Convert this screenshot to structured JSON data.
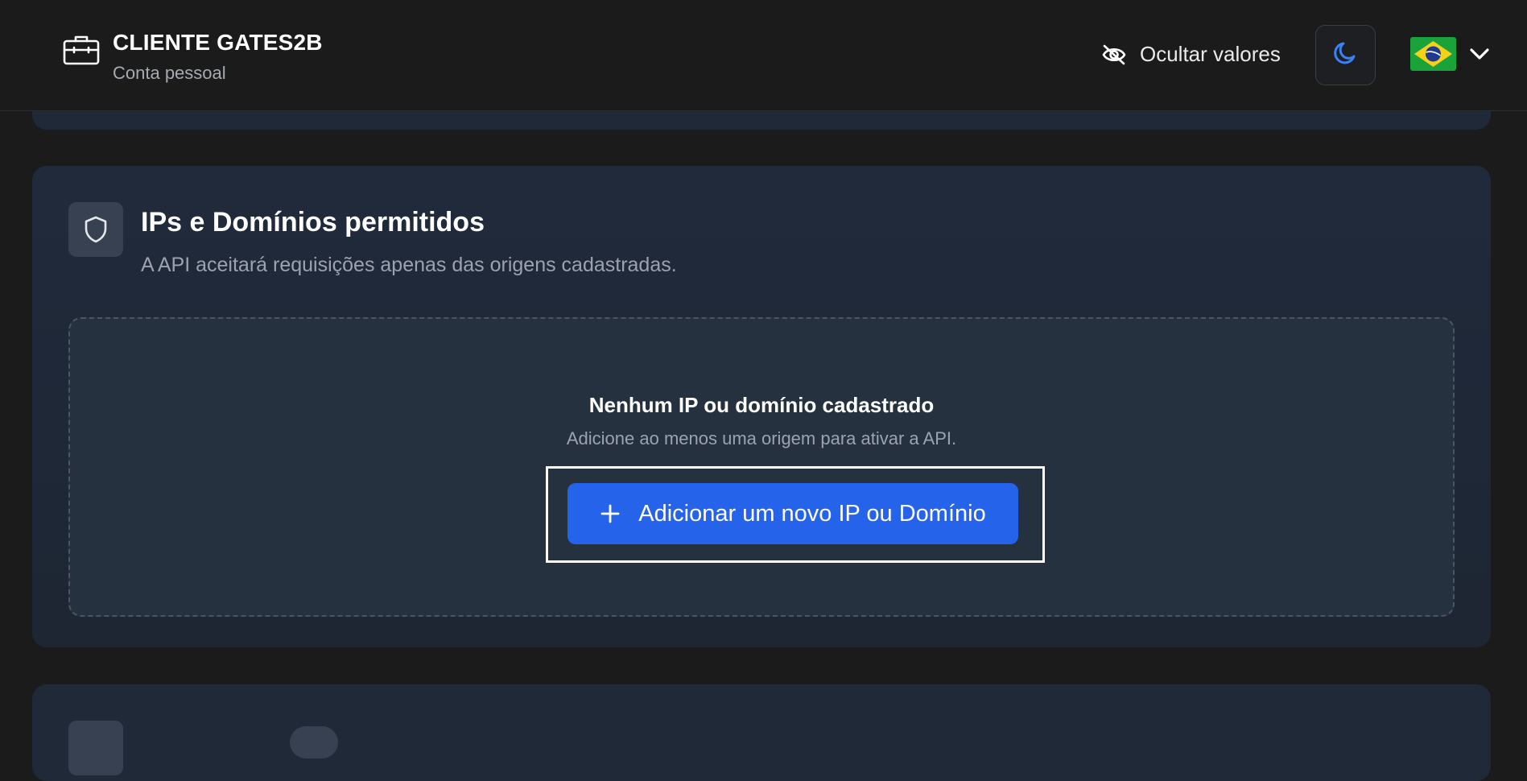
{
  "header": {
    "account_name": "CLIENTE GATES2B",
    "account_type": "Conta pessoal",
    "hide_values_label": "Ocultar valores",
    "theme_icon": "moon-icon",
    "language_flag": "brazil-flag-icon"
  },
  "ip_section": {
    "title": "IPs e Domínios permitidos",
    "description": "A API aceitará requisições apenas das origens cadastradas.",
    "empty_title": "Nenhum IP ou domínio cadastrado",
    "empty_description": "Adicione ao menos uma origem para ativar a API.",
    "add_button_label": "Adicionar um novo IP ou Domínio"
  },
  "colors": {
    "background": "#1b1b1c",
    "card": "#1f2937",
    "accent": "#2563eb",
    "muted_text": "#9ca3af"
  }
}
